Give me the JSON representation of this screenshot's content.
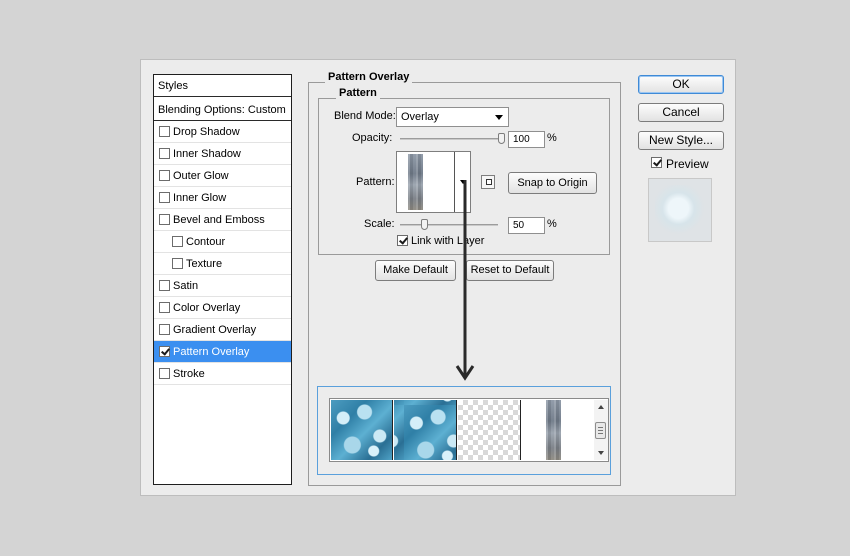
{
  "styles_panel": {
    "header": "Styles",
    "blending_options": "Blending Options: Custom",
    "items": [
      {
        "label": "Drop Shadow",
        "checked": false
      },
      {
        "label": "Inner Shadow",
        "checked": false
      },
      {
        "label": "Outer Glow",
        "checked": false
      },
      {
        "label": "Inner Glow",
        "checked": false
      },
      {
        "label": "Bevel and Emboss",
        "checked": false
      },
      {
        "label": "Contour",
        "checked": false
      },
      {
        "label": "Texture",
        "checked": false
      },
      {
        "label": "Satin",
        "checked": false
      },
      {
        "label": "Color Overlay",
        "checked": false
      },
      {
        "label": "Gradient Overlay",
        "checked": false
      },
      {
        "label": "Pattern Overlay",
        "checked": true
      },
      {
        "label": "Stroke",
        "checked": false
      }
    ],
    "selected": "Pattern Overlay",
    "selected_color": "#3b8ff0"
  },
  "pattern_overlay": {
    "group_title": "Pattern Overlay",
    "subgroup_title": "Pattern",
    "blend_mode_label": "Blend Mode:",
    "blend_mode_value": "Overlay",
    "opacity_label": "Opacity:",
    "opacity_value": "100",
    "opacity_unit": "%",
    "opacity_level": 1.0,
    "pattern_label": "Pattern:",
    "snap_to_origin": "Snap to Origin",
    "scale_label": "Scale:",
    "scale_value": "50",
    "scale_unit": "%",
    "scale_level": 0.5,
    "link_with_layer": "Link with Layer",
    "link_with_layer_checked": true,
    "make_default": "Make Default",
    "reset_to_default": "Reset to Default"
  },
  "pattern_picker": {
    "swatches": [
      "blue-rock-pattern",
      "blue-rock-pattern",
      "transparent-pattern",
      "wood-grain-pattern"
    ],
    "highlight_color": "#5aa0dc"
  },
  "right_panel": {
    "ok": "OK",
    "cancel": "Cancel",
    "new_style": "New Style...",
    "preview_label": "Preview",
    "preview_checked": true
  }
}
